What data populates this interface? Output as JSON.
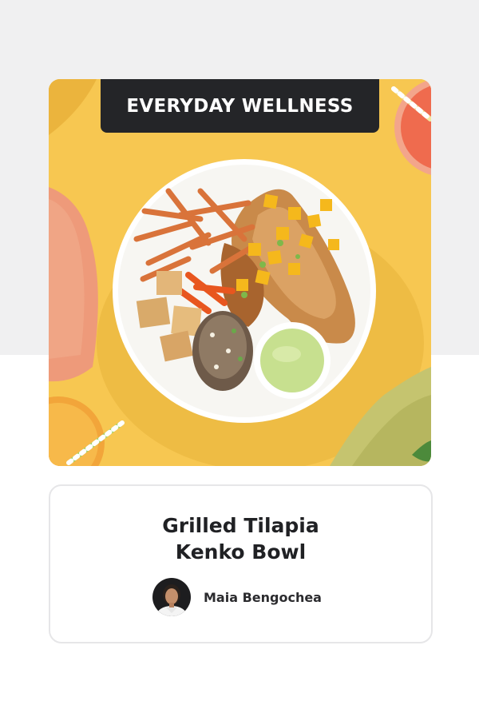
{
  "banner": {
    "label": "EVERYDAY WELLNESS"
  },
  "recipe": {
    "title_line_1": "Grilled Tilapia",
    "title_line_2": "Kenko Bowl",
    "image_alt": "Grilled Tilapia Kenko Bowl"
  },
  "author": {
    "name": "Maia Bengochea",
    "avatar_icon": "avatar-photo"
  },
  "colors": {
    "page_bg": "#ffffff",
    "band_bg": "#f0f0f1",
    "banner_bg": "#242528",
    "banner_text": "#ffffff",
    "title_text": "#202124",
    "hero_bg": "#f7c751"
  }
}
